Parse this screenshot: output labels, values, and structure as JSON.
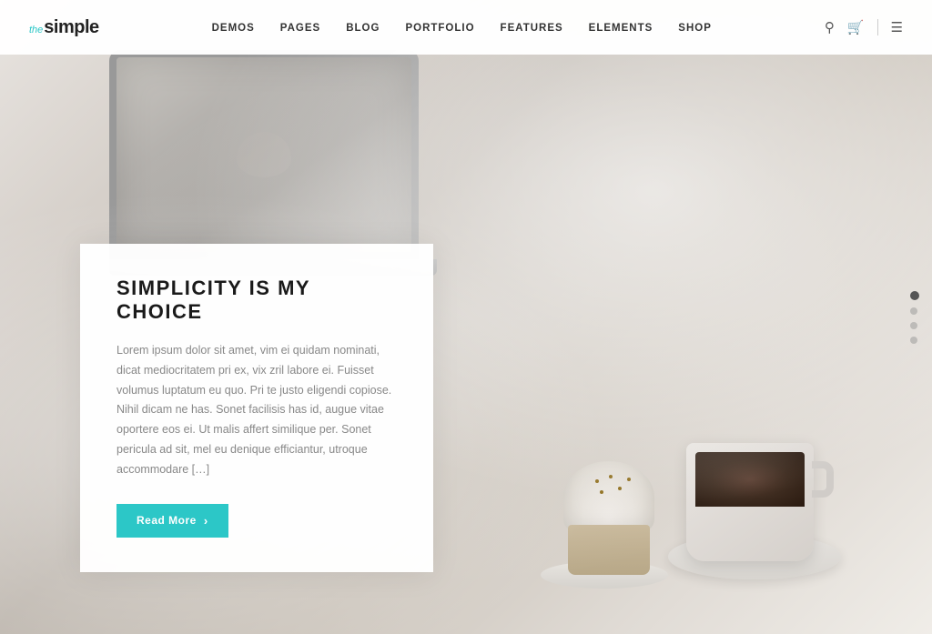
{
  "nav": {
    "logo_prefix": "the",
    "logo_main": "simple",
    "links": [
      {
        "id": "demos",
        "label": "DEMOS"
      },
      {
        "id": "pages",
        "label": "PAGES"
      },
      {
        "id": "blog",
        "label": "BLOG"
      },
      {
        "id": "portfolio",
        "label": "PORTFOLIO"
      },
      {
        "id": "features",
        "label": "FEATURES"
      },
      {
        "id": "elements",
        "label": "ELEMENTS"
      },
      {
        "id": "shop",
        "label": "SHOP"
      }
    ]
  },
  "hero": {
    "card": {
      "title": "SIMPLICITY IS MY CHOICE",
      "body": "Lorem ipsum dolor sit amet, vim ei quidam nominati, dicat mediocritatem pri ex, vix zril labore ei. Fuisset volumus luptatum eu quo. Pri te justo eligendi copiose. Nihil dicam ne has. Sonet facilisis has id, augue vitae oportere eos ei. Ut malis affert similique per. Sonet pericula ad sit, mel eu denique efficiantur, utroque accommodare […]",
      "read_more_label": "Read More",
      "read_more_arrow": "›"
    }
  },
  "slider": {
    "dots": [
      {
        "id": 1,
        "active": true
      },
      {
        "id": 2,
        "active": false
      },
      {
        "id": 3,
        "active": false
      },
      {
        "id": 4,
        "active": false
      }
    ]
  },
  "colors": {
    "accent": "#2cc7c7",
    "text_dark": "#1a1a1a",
    "text_muted": "#888888"
  }
}
